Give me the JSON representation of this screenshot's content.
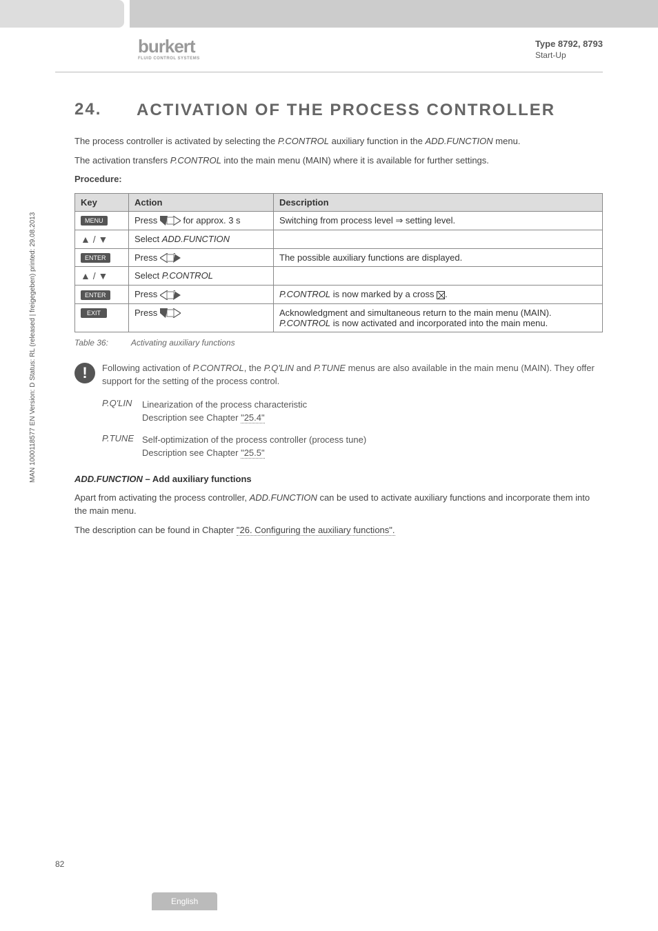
{
  "header": {
    "logo_main": "burkert",
    "logo_sub": "FLUID CONTROL SYSTEMS",
    "type_label": "Type 8792, 8793",
    "section_label": "Start-Up"
  },
  "section": {
    "number": "24.",
    "title": "ACTIVATION OF THE PROCESS CONTROLLER"
  },
  "intro": {
    "p1_a": "The process controller is activated by selecting the ",
    "p1_b": "P.CONTROL",
    "p1_c": " auxiliary function in the ",
    "p1_d": "ADD.FUNCTION",
    "p1_e": " menu.",
    "p2_a": "The activation transfers ",
    "p2_b": "P.CONTROL",
    "p2_c": " into the main menu (MAIN) where it is available for further settings.",
    "proc_label": "Procedure:"
  },
  "table": {
    "h_key": "Key",
    "h_action": "Action",
    "h_desc": "Description",
    "rows": [
      {
        "key": "MENU",
        "action_prefix": "Press ",
        "action_suffix": " for approx. 3 s",
        "desc_a": "Switching from process level ",
        "desc_b": " setting level."
      },
      {
        "key_arrows": "▲ / ▼",
        "action_a": "Select ",
        "action_b": "ADD.FUNCTION",
        "desc": ""
      },
      {
        "key": "ENTER",
        "action_prefix": "Press ",
        "desc": "The possible auxiliary functions are displayed."
      },
      {
        "key_arrows": "▲ / ▼",
        "action_a": "Select ",
        "action_b": "P.CONTROL",
        "desc": ""
      },
      {
        "key": "ENTER",
        "action_prefix": "Press ",
        "desc_a": "P.CONTROL",
        "desc_b": " is now marked by a cross "
      },
      {
        "key": "EXIT",
        "action_prefix": "Press ",
        "desc_a": "Acknowledgment and simultaneous return to the main menu (MAIN). ",
        "desc_b": "P.CONTROL",
        "desc_c": " is now activated and incorporated into the main menu."
      }
    ]
  },
  "caption": {
    "num": "Table 36:",
    "text": "Activating auxiliary functions"
  },
  "note": {
    "a": "Following activation of ",
    "b": "P.CONTROL",
    "c": ", the ",
    "d": "P.Q'LIN",
    "e": " and ",
    "f": "P.TUNE",
    "g": " menus are also available in the main menu (MAIN). They offer support for the setting of the process control."
  },
  "subs": {
    "pqlin_label": "P.Q'LIN",
    "pqlin_l1": "Linearization of the process characteristic",
    "pqlin_l2a": "Description see Chapter ",
    "pqlin_l2b": "\"25.4\"",
    "ptune_label": "P.TUNE",
    "ptune_l1": "Self-optimization of the process controller (process tune)",
    "ptune_l2a": "Description see Chapter ",
    "ptune_l2b": "\"25.5\""
  },
  "addfunc": {
    "title_a": "ADD.FUNCTION",
    "title_b": " – Add auxiliary functions",
    "p1_a": "Apart from activating the process controller, ",
    "p1_b": "ADD.FUNCTION",
    "p1_c": " can be used to activate auxiliary functions and incorporate them into the main menu.",
    "p2_a": "The description can be found in Chapter ",
    "p2_b": "\"26. Configuring the auxiliary functions\"."
  },
  "side_text": "MAN 1000118577 EN Version: D Status: RL (released | freigegeben) printed: 29.08.2013",
  "page_num": "82",
  "footer_tab": "English"
}
